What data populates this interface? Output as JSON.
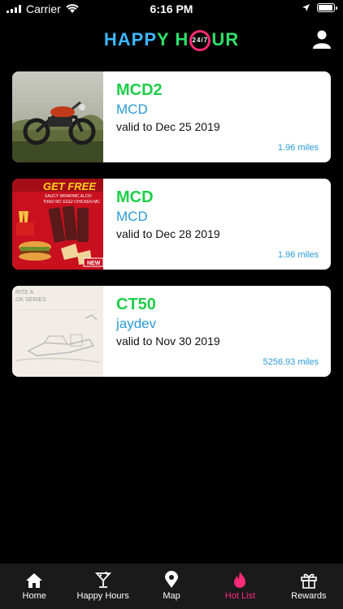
{
  "status_bar": {
    "carrier": "Carrier",
    "time": "6:16 PM",
    "battery_level": 0.92
  },
  "header": {
    "logo_part1": "HAPP",
    "logo_part2": "Y H",
    "logo_ring": "24/7",
    "logo_part3": "UR",
    "profile_icon": "user-icon"
  },
  "offers": [
    {
      "code": "MCD2",
      "merchant": "MCD",
      "valid": "valid to Dec 25 2019",
      "distance": "1.96 miles",
      "thumb": "motorcycle-photo"
    },
    {
      "code": "MCD",
      "merchant": "MCD",
      "valid": "valid to Dec 28 2019",
      "distance": "1.96 miles",
      "thumb": "mcdonalds-promo",
      "thumb_text": "GET FREE",
      "thumb_sub": "SAUCY WRAP/MC ALOO",
      "thumb_sub2": "TIKKI/ MC EGG/ CHICKEN MC",
      "thumb_badge": "NEW"
    },
    {
      "code": "CT50",
      "merchant": "jaydev",
      "valid": "valid to Nov 30 2019",
      "distance": "5256.93 miles",
      "thumb": "sketch-illustration",
      "thumb_text": "RITE A",
      "thumb_sub": "OK SERIES"
    }
  ],
  "tabs": [
    {
      "label": "Home",
      "icon": "home-icon",
      "active": false
    },
    {
      "label": "Happy Hours",
      "icon": "cocktail-icon",
      "active": false
    },
    {
      "label": "Map",
      "icon": "map-pin-icon",
      "active": false
    },
    {
      "label": "Hot List",
      "icon": "flame-icon",
      "active": true
    },
    {
      "label": "Rewards",
      "icon": "gift-icon",
      "active": false
    }
  ],
  "colors": {
    "accent_pink": "#ff2a78",
    "code_green": "#1fce4a",
    "link_blue": "#2a9bd6"
  }
}
